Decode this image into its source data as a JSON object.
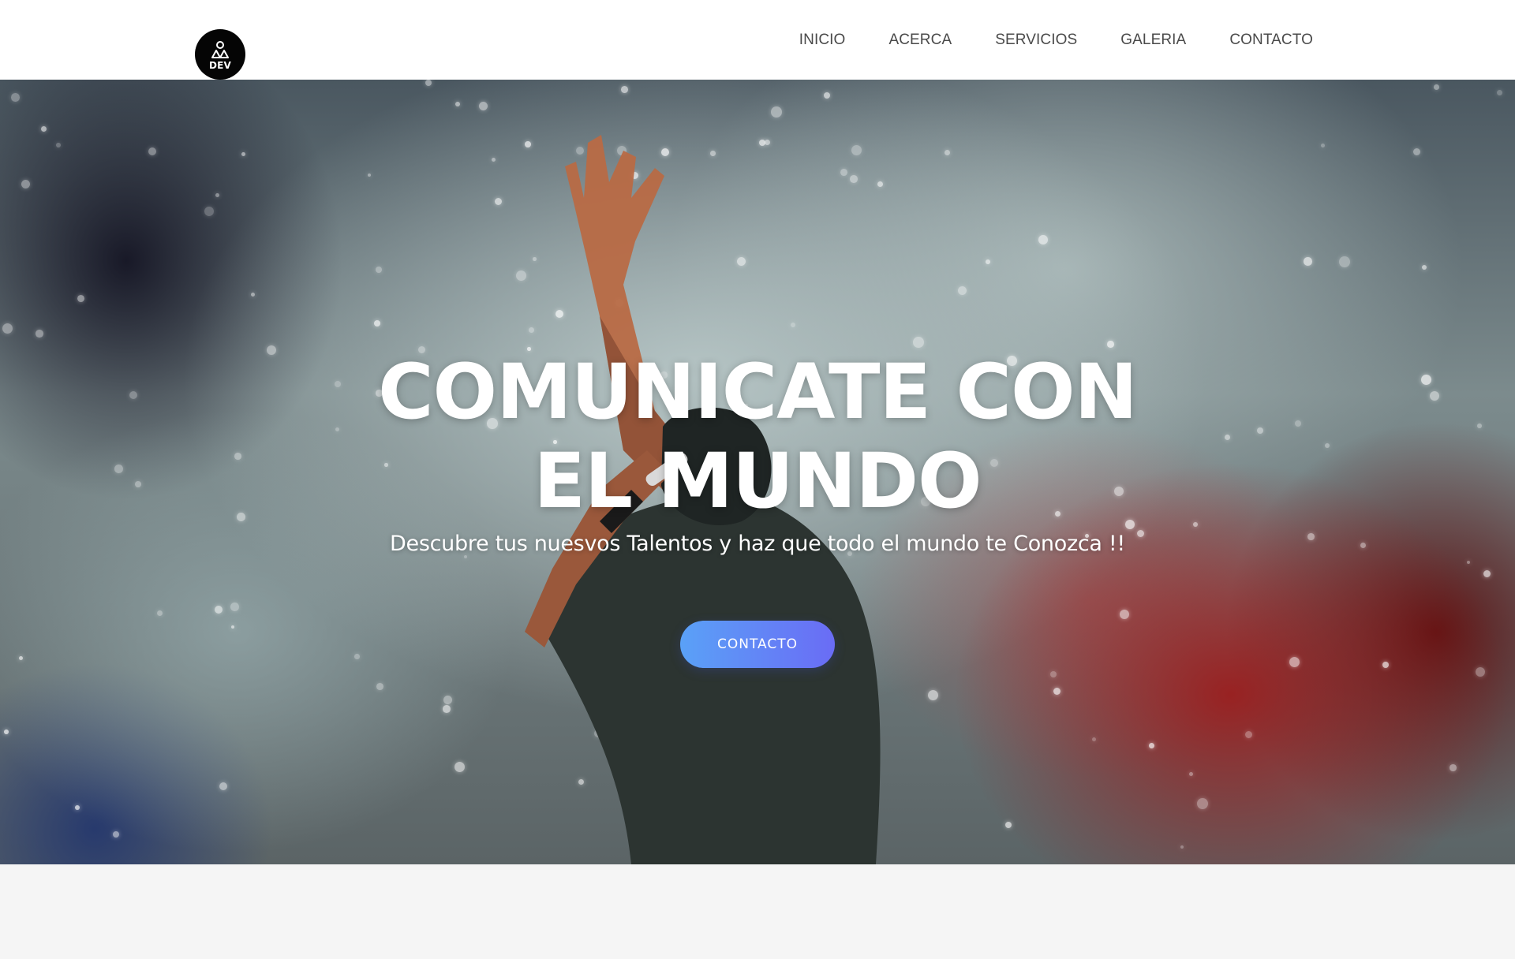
{
  "brand": {
    "logo_text": "DEV",
    "logo_icon": "people-icon"
  },
  "nav": {
    "items": [
      {
        "label": "INICIO"
      },
      {
        "label": "ACERCA"
      },
      {
        "label": "SERVICIOS"
      },
      {
        "label": "GALERIA"
      },
      {
        "label": "CONTACTO"
      }
    ]
  },
  "hero": {
    "title_line1": "COMUNICATE CON",
    "title_line2": "EL MUNDO",
    "subtitle": "Descubre tus nuesvos Talentos y haz que todo el mundo te Conozca !!",
    "cta_label": "CONTACTO",
    "background": "concert-performer-photo"
  },
  "colors": {
    "header_bg": "#ffffff",
    "nav_text": "#4a4a4a",
    "logo_bg": "#050505",
    "cta_gradient_start": "#5aa1f7",
    "cta_gradient_end": "#6a6cf5",
    "page_bg": "#f5f5f5"
  }
}
